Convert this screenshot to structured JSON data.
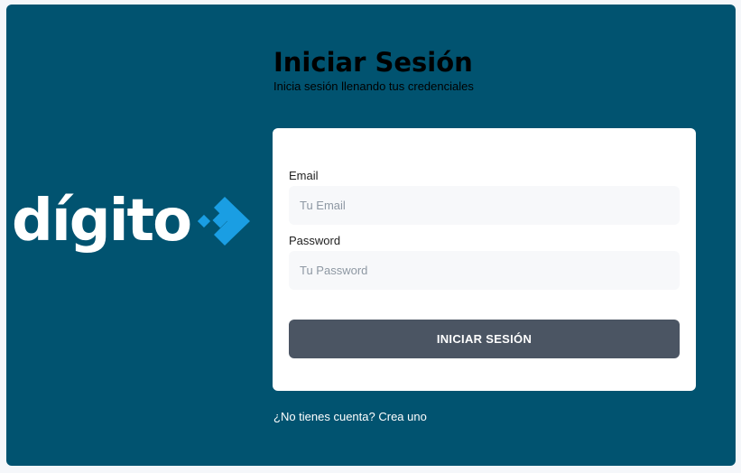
{
  "brand": {
    "name": "dígito",
    "accent_color": "#1a9ee3",
    "background_color": "#015370"
  },
  "header": {
    "title": "Iniciar Sesión",
    "subtitle": "Inicia sesión llenando tus credenciales"
  },
  "form": {
    "email_label": "Email",
    "email_placeholder": "Tu Email",
    "email_value": "",
    "password_label": "Password",
    "password_placeholder": "Tu Password",
    "password_value": "",
    "submit_label": "INICIAR SESIÓN",
    "submit_color": "#4b5563"
  },
  "footer": {
    "signup_link": "¿No tienes cuenta? Crea uno"
  }
}
